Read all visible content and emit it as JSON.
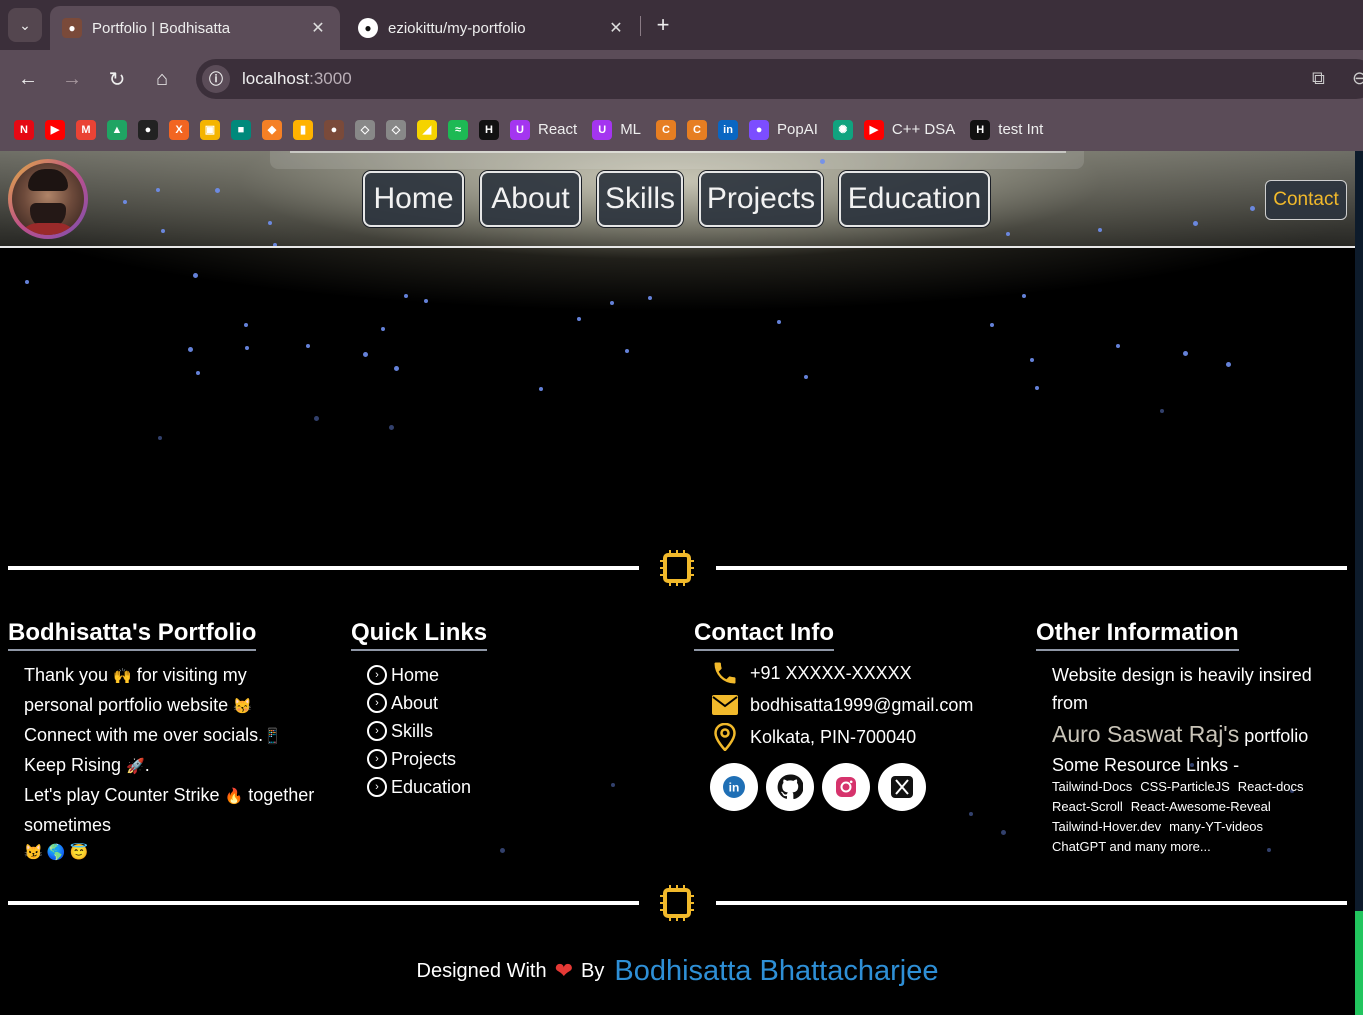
{
  "browser": {
    "tabs": [
      {
        "title": "Portfolio | Bodhisatta",
        "active": true
      },
      {
        "title": "eziokittu/my-portfolio",
        "active": false
      }
    ],
    "url_host": "localhost",
    "url_port": ":3000",
    "bookmarks": [
      {
        "icon": "netflix-icon",
        "label": "",
        "color": "#e50914",
        "glyph": "N"
      },
      {
        "icon": "youtube-icon",
        "label": "",
        "color": "#ff0000",
        "glyph": "▶"
      },
      {
        "icon": "gmail-icon",
        "label": "",
        "color": "#ea4335",
        "glyph": "M"
      },
      {
        "icon": "google-drive-icon",
        "label": "",
        "color": "#1fa463",
        "glyph": "▲"
      },
      {
        "icon": "github-icon",
        "label": "",
        "color": "#222222",
        "glyph": "●"
      },
      {
        "icon": "x-app-icon",
        "label": "",
        "color": "#f26522",
        "glyph": "X"
      },
      {
        "icon": "google-classroom-icon",
        "label": "",
        "color": "#f4b400",
        "glyph": "▣"
      },
      {
        "icon": "google-meet-icon",
        "label": "",
        "color": "#00897b",
        "glyph": "■"
      },
      {
        "icon": "stack-icon",
        "label": "",
        "color": "#f58025",
        "glyph": "◆"
      },
      {
        "icon": "chart-bars-icon",
        "label": "",
        "color": "#ffb300",
        "glyph": "▮"
      },
      {
        "icon": "profile-photo-icon",
        "label": "",
        "color": "#7a4a3a",
        "glyph": "●"
      },
      {
        "icon": "unity-icon",
        "label": "",
        "color": "#888888",
        "glyph": "◇"
      },
      {
        "icon": "unity-icon-2",
        "label": "",
        "color": "#888888",
        "glyph": "◇"
      },
      {
        "icon": "yellow-app-icon",
        "label": "",
        "color": "#f5d300",
        "glyph": "◢"
      },
      {
        "icon": "spotify-icon",
        "label": "",
        "color": "#1db954",
        "glyph": "≈"
      },
      {
        "icon": "hackerrank-icon",
        "label": "",
        "color": "#111111",
        "glyph": "H"
      },
      {
        "icon": "udemy-icon",
        "label": "React",
        "color": "#a435f0",
        "glyph": "U"
      },
      {
        "icon": "udemy-icon",
        "label": "ML",
        "color": "#a435f0",
        "glyph": "U"
      },
      {
        "icon": "codechef-icon",
        "label": "",
        "color": "#e67e22",
        "glyph": "C"
      },
      {
        "icon": "codechef-icon-2",
        "label": "",
        "color": "#e67e22",
        "glyph": "C"
      },
      {
        "icon": "linkedin-icon",
        "label": "",
        "color": "#0a66c2",
        "glyph": "in"
      },
      {
        "icon": "popai-icon",
        "label": "PopAI",
        "color": "#7c4dff",
        "glyph": "●"
      },
      {
        "icon": "chatgpt-icon",
        "label": "",
        "color": "#10a37f",
        "glyph": "✺"
      },
      {
        "icon": "youtube-icon",
        "label": "C++ DSA",
        "color": "#ff0000",
        "glyph": "▶"
      },
      {
        "icon": "hackerrank-icon",
        "label": "test Int",
        "color": "#111111",
        "glyph": "H"
      }
    ]
  },
  "header": {
    "nav": [
      "Home",
      "About",
      "Skills",
      "Projects",
      "Education"
    ],
    "contact_label": "Contact"
  },
  "footer": {
    "portfolio": {
      "title": "Bodhisatta's Portfolio",
      "line1": "Thank you",
      "line1_emoji": "🙌",
      "line1_end": "for visiting my",
      "line2": "personal portfolio website",
      "line2_emoji": "😽",
      "line3": "Connect with me over socials.",
      "line3_emoji": "📱",
      "line4": "Keep Rising",
      "line4_emoji": "🚀",
      "line4_end": ".",
      "line5": "Let's play Counter Strike",
      "line5_emoji": "🔥",
      "line5_end": "together",
      "line6": "sometimes",
      "line7_emojis": "😼 🌎 😇"
    },
    "quick_links": {
      "title": "Quick Links",
      "items": [
        "Home",
        "About",
        "Skills",
        "Projects",
        "Education"
      ]
    },
    "contact": {
      "title": "Contact Info",
      "phone": "+91 XXXXX-XXXXX",
      "email": "bodhisatta1999@gmail.com",
      "location": "Kolkata, PIN-700040",
      "socials": [
        "linkedin-icon",
        "github-icon",
        "instagram-icon",
        "x-icon"
      ]
    },
    "other": {
      "title": "Other Information",
      "design_text": "Website design is heavily insired from",
      "inspiration_name": "Auro Saswat Raj's",
      "inspiration_suffix": "portfolio",
      "resources_heading": "Some Resource Links -",
      "resources": [
        "Tailwind-Docs",
        "CSS-ParticleJS",
        "React-docs",
        "React-Scroll",
        "React-Awesome-Reveal",
        "Tailwind-Hover.dev",
        "many-YT-videos",
        "ChatGPT and many more..."
      ]
    },
    "credit": {
      "prefix": "Designed With",
      "by": "By",
      "author": "Bodhisatta Bhattacharjee"
    }
  },
  "colors": {
    "accent_contact": "#f1b92b",
    "author_link": "#2e8fd6",
    "scroll_thumb": "#22c55e",
    "chip": "#f1b92b"
  }
}
